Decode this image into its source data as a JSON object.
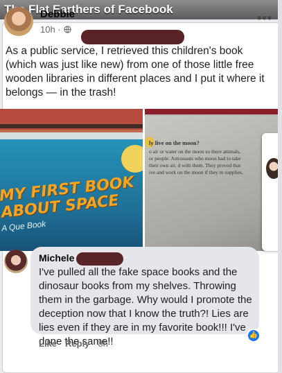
{
  "banner": {
    "title": "The Flat Earthers of Facebook"
  },
  "post": {
    "author": "Debbie",
    "time": "10h ·",
    "more_label": "•••",
    "text": "As a public service, I retrieved this children's book (which was just like new) from one of those little free wooden libraries in different places and I put it where it belongs — in the trash!",
    "photo_left": {
      "book_title": "MY FIRST BOOK ABOUT SPACE",
      "book_subtitle": "A Que            Book"
    },
    "photo_right": {
      "heading": "ly live on the moon?",
      "text": "o air or water on the moon so there animals, or people. Astronauts who moon had to take their own air. d with them. They proved that ive and work on the moon if they m supplies."
    }
  },
  "comment": {
    "author": "Michele",
    "text": "I've pulled all the fake space books and the dinosaur books from my shelves. Throwing them in the garbage. Why would I promote the deception now that I know the truth?! Lies are lies even if they are in my favorite book!!! I've done the same!!",
    "actions": {
      "like": "Like",
      "reply": "Reply",
      "time": "8h"
    },
    "like_badge": "👍"
  },
  "icons": [
    "globe-icon",
    "more-icon",
    "like-badge-icon"
  ],
  "colors": {
    "banner": "#6f6f6f",
    "redaction": "#5a2328",
    "bubble": "#e4e6eb",
    "like": "#1877f2"
  }
}
